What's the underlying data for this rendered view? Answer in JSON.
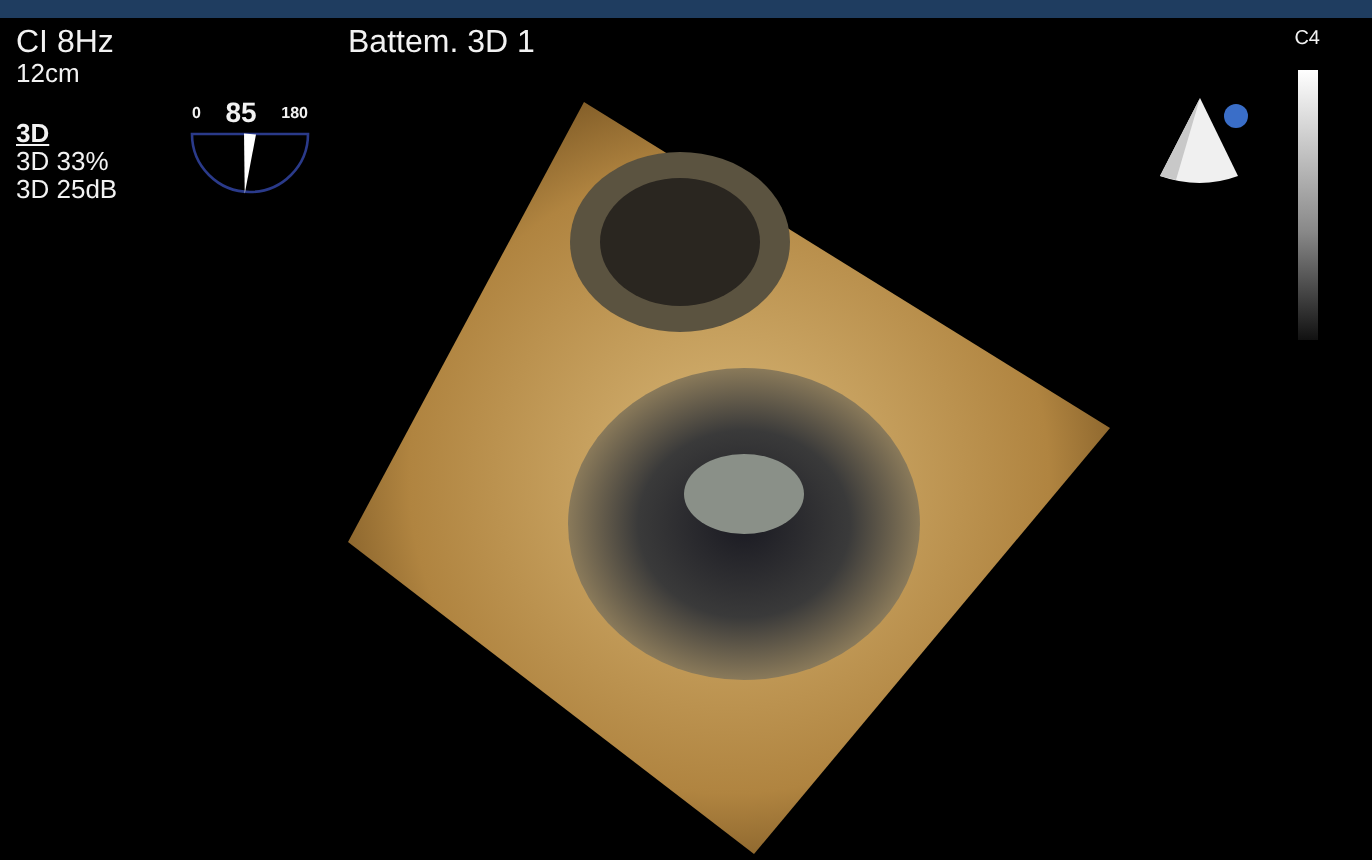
{
  "header": {
    "frame_rate": "CI 8Hz",
    "depth": "12cm",
    "title": "Battem. 3D 1"
  },
  "settings": {
    "mode": "3D",
    "lines": [
      "3D 33%",
      "3D 25dB"
    ]
  },
  "gauge": {
    "min": "0",
    "value": "85",
    "max": "180",
    "level": 0.472
  },
  "scale": {
    "label": "C4"
  }
}
